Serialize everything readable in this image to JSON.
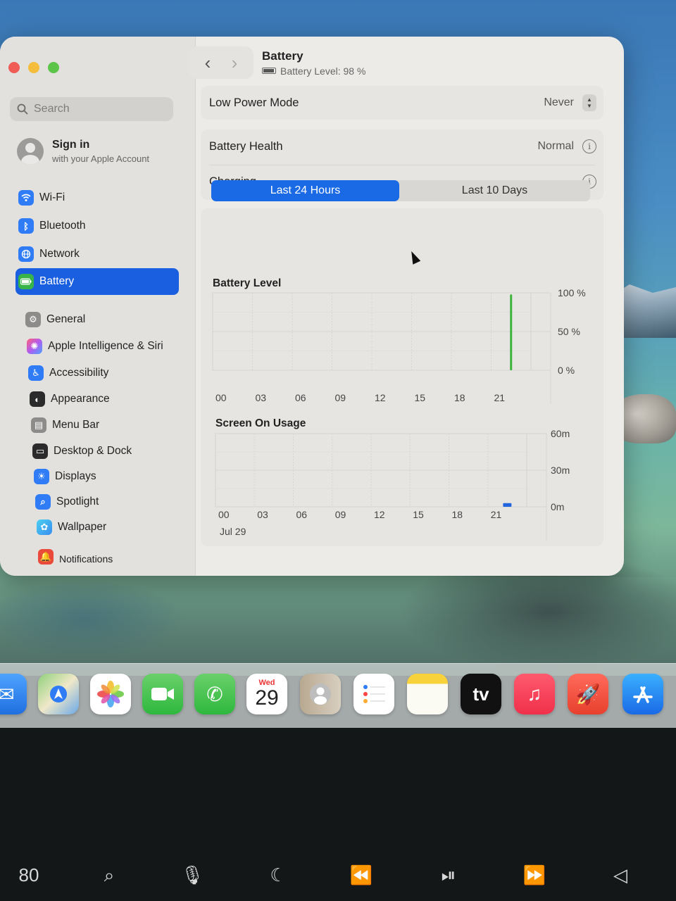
{
  "window": {
    "title": "Battery",
    "subtitle": "Battery Level: 98 %"
  },
  "sidebar": {
    "search_placeholder": "Search",
    "account": {
      "title": "Sign in",
      "subtitle": "with your Apple Account"
    },
    "items": [
      {
        "label": "Wi-Fi",
        "icon": "wifi-icon"
      },
      {
        "label": "Bluetooth",
        "icon": "bluetooth-icon"
      },
      {
        "label": "Network",
        "icon": "globe-icon"
      },
      {
        "label": "Battery",
        "icon": "battery-icon",
        "active": true
      },
      {
        "label": "General",
        "icon": "gear-icon"
      },
      {
        "label": "Apple Intelligence & Siri",
        "icon": "siri-icon"
      },
      {
        "label": "Accessibility",
        "icon": "accessibility-icon"
      },
      {
        "label": "Appearance",
        "icon": "appearance-icon"
      },
      {
        "label": "Menu Bar",
        "icon": "menu-bar-icon"
      },
      {
        "label": "Desktop & Dock",
        "icon": "dock-icon"
      },
      {
        "label": "Displays",
        "icon": "sun-icon"
      },
      {
        "label": "Spotlight",
        "icon": "magnifier-icon"
      },
      {
        "label": "Wallpaper",
        "icon": "flower-icon"
      },
      {
        "label": "Notifications",
        "icon": "bell-icon"
      }
    ]
  },
  "settings": {
    "low_power_mode": {
      "label": "Low Power Mode",
      "value": "Never"
    },
    "battery_health": {
      "label": "Battery Health",
      "value": "Normal"
    },
    "charging": {
      "label": "Charging"
    }
  },
  "segmented": {
    "options": [
      "Last 24 Hours",
      "Last 10 Days"
    ],
    "selected": 0
  },
  "colors": {
    "accent": "#1a6ae6",
    "battery_bar": "#3cb43c",
    "usage_bar": "#2266dd"
  },
  "chart_data": [
    {
      "type": "bar",
      "title": "Battery Level",
      "x_ticks": [
        "00",
        "03",
        "06",
        "09",
        "12",
        "15",
        "18",
        "21"
      ],
      "y_ticks": [
        "100 %",
        "50 %",
        "0 %"
      ],
      "ylim": [
        0,
        100
      ],
      "bars": [
        {
          "hour": 22.5,
          "value": 98
        }
      ]
    },
    {
      "type": "bar",
      "title": "Screen On Usage",
      "x_ticks": [
        "00",
        "03",
        "06",
        "09",
        "12",
        "15",
        "18",
        "21"
      ],
      "date_label": "Jul 29",
      "y_ticks": [
        "60m",
        "30m",
        "0m"
      ],
      "ylim": [
        0,
        60
      ],
      "bars": [
        {
          "hour": 22.5,
          "value": 3
        }
      ]
    }
  ],
  "dock": {
    "apps": [
      {
        "name": "Mail",
        "icon": "mail-icon"
      },
      {
        "name": "Maps",
        "icon": "maps-icon"
      },
      {
        "name": "Photos",
        "icon": "photos-icon"
      },
      {
        "name": "FaceTime",
        "icon": "facetime-icon"
      },
      {
        "name": "Phone",
        "icon": "phone-icon"
      },
      {
        "name": "Calendar",
        "icon": "calendar-icon",
        "day": "Wed",
        "date": "29"
      },
      {
        "name": "Contacts",
        "icon": "contacts-icon"
      },
      {
        "name": "Reminders",
        "icon": "reminders-icon"
      },
      {
        "name": "Notes",
        "icon": "notes-icon"
      },
      {
        "name": "TV",
        "icon": "tv-icon",
        "label": "tv"
      },
      {
        "name": "Music",
        "icon": "music-icon"
      },
      {
        "name": "Launchpad",
        "icon": "rocket-icon"
      },
      {
        "name": "App Store",
        "icon": "app-store-icon"
      }
    ]
  },
  "touchbar": {
    "keys": [
      "mission-control-icon",
      "search-icon",
      "microphone-icon",
      "moon-icon",
      "rewind-icon",
      "play-pause-icon",
      "fast-forward-icon",
      "volume-icon"
    ],
    "labels": [
      "80",
      "⌕",
      "🎙",
      "☾",
      "⏪",
      "⏯",
      "⏩",
      "◁"
    ]
  }
}
